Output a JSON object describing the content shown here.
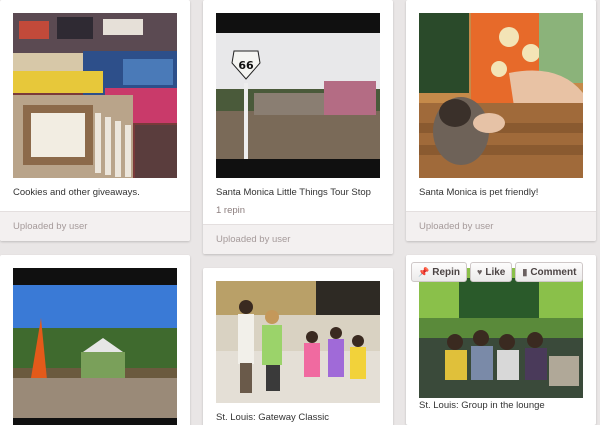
{
  "pins": [
    {
      "caption": "Cookies and other giveaways.",
      "footer": "Uploaded by user"
    },
    {
      "caption": "Santa Monica Little Things Tour Stop",
      "repins": "1 repin",
      "footer": "Uploaded by user",
      "sign_text": "66"
    },
    {
      "caption": "Santa Monica is pet friendly!",
      "footer": "Uploaded by user"
    },
    {
      "caption": ""
    },
    {
      "caption": "St. Louis: Gateway Classic"
    },
    {
      "caption": "St. Louis: Group in the lounge"
    }
  ],
  "actions": {
    "repin_label": "Repin",
    "like_label": "Like",
    "comment_label": "Comment",
    "repin_icon": "pin-icon",
    "like_icon": "heart-icon",
    "comment_icon": "speech-bubble-icon"
  }
}
